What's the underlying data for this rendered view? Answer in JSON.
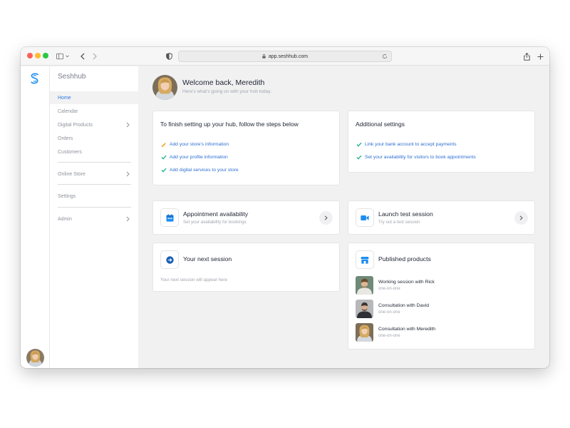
{
  "browser": {
    "url": "app.seshhub.com"
  },
  "sidebar": {
    "brand": "Seshhub",
    "items": [
      {
        "label": "Home"
      },
      {
        "label": "Calendar"
      },
      {
        "label": "Digital Products"
      },
      {
        "label": "Orders"
      },
      {
        "label": "Customers"
      },
      {
        "label": "Online Store"
      },
      {
        "label": "Settings"
      },
      {
        "label": "Admin"
      }
    ]
  },
  "header": {
    "title": "Welcome back, Meredith",
    "subtitle": "Here's what's going on with your hub today."
  },
  "setup": {
    "title": "To finish setting up your hub, follow the steps below",
    "steps": [
      {
        "label": "Add your store's information",
        "icon": "pencil-icon",
        "color": "#f5a623"
      },
      {
        "label": "Add your profile information",
        "icon": "check-icon",
        "color": "#1fb58f"
      },
      {
        "label": "Add digital services to your store",
        "icon": "check-icon",
        "color": "#1fb58f"
      }
    ]
  },
  "additional": {
    "title": "Additional settings",
    "steps": [
      {
        "label": "Link your bank account to accept payments",
        "icon": "check-icon",
        "color": "#1fb58f"
      },
      {
        "label": "Set your availability for visitors to book appointments",
        "icon": "check-icon",
        "color": "#1fb58f"
      }
    ]
  },
  "appointment": {
    "title": "Appointment availability",
    "subtitle": "Set your availability for bookings",
    "icon": "calendar-icon"
  },
  "launch": {
    "title": "Launch test session",
    "subtitle": "Try out a test session",
    "icon": "video-icon"
  },
  "next_session": {
    "title": "Your next session",
    "empty_text": "Your next session will appear here",
    "icon": "arrow-right-circle-icon"
  },
  "products": {
    "title": "Published products",
    "icon": "store-icon",
    "items": [
      {
        "name": "Working session with Rick",
        "type": "one-on-one"
      },
      {
        "name": "Consultation with David",
        "type": "one-on-one"
      },
      {
        "name": "Consultation with Meredith",
        "type": "one-on-one"
      }
    ]
  },
  "colors": {
    "accent": "#2d76e0",
    "check": "#1fb58f",
    "pencil": "#f5a623",
    "icon_blue": "#1d8df0"
  }
}
